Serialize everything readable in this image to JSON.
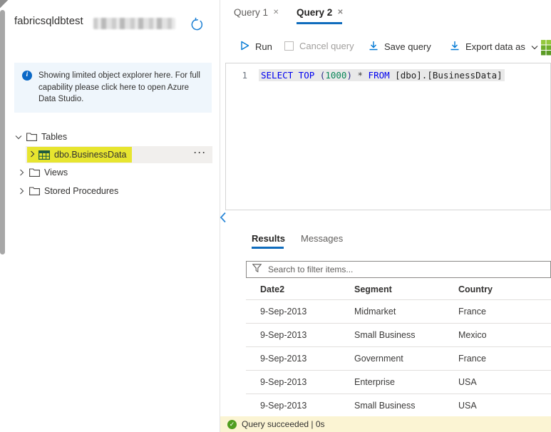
{
  "sidebar": {
    "title": "fabricsqldbtest",
    "info_banner": {
      "text": "Showing limited object explorer here. For full capability please click here to open Azure Data Studio."
    },
    "tree": {
      "tables": {
        "label": "Tables"
      },
      "business_data": {
        "label": "dbo.BusinessData",
        "more": "···"
      },
      "views": {
        "label": "Views"
      },
      "stored_procedures": {
        "label": "Stored Procedures"
      }
    }
  },
  "query_editor": {
    "tabs": {
      "tab1": {
        "label": "Query 1"
      },
      "tab2": {
        "label": "Query 2"
      }
    },
    "toolbar": {
      "run": "Run",
      "cancel": "Cancel query",
      "save": "Save query",
      "export": "Export data as"
    },
    "code": {
      "line_number": "1",
      "kw1": "SELECT TOP ",
      "paren_open": "(",
      "number": "1000",
      "paren_close": ")",
      "star": " * ",
      "kw2": "FROM",
      "identifier": " [dbo].[BusinessData]"
    }
  },
  "results_panel": {
    "tabs": {
      "results": "Results",
      "messages": "Messages"
    },
    "search_placeholder": "Search to filter items...",
    "columns": [
      "Date2",
      "Segment",
      "Country"
    ],
    "rows": [
      [
        "9-Sep-2013",
        "Midmarket",
        "France"
      ],
      [
        "9-Sep-2013",
        "Small Business",
        "Mexico"
      ],
      [
        "9-Sep-2013",
        "Government",
        "France"
      ],
      [
        "9-Sep-2013",
        "Enterprise",
        "USA"
      ],
      [
        "9-Sep-2013",
        "Small Business",
        "USA"
      ]
    ],
    "status": "Query succeeded | 0s"
  },
  "icons": {
    "close": "✕",
    "info": "i",
    "check": "✓"
  },
  "colors": {
    "accent_blue": "#0f6cbd",
    "icon_blue": "#0078d4",
    "highlight_yellow": "#e7e52f",
    "info_banner_bg": "#eff6fc",
    "status_bar_bg": "#fbf4d3",
    "success_green": "#4f9e1f",
    "selected_row_bg": "#f1efed"
  }
}
